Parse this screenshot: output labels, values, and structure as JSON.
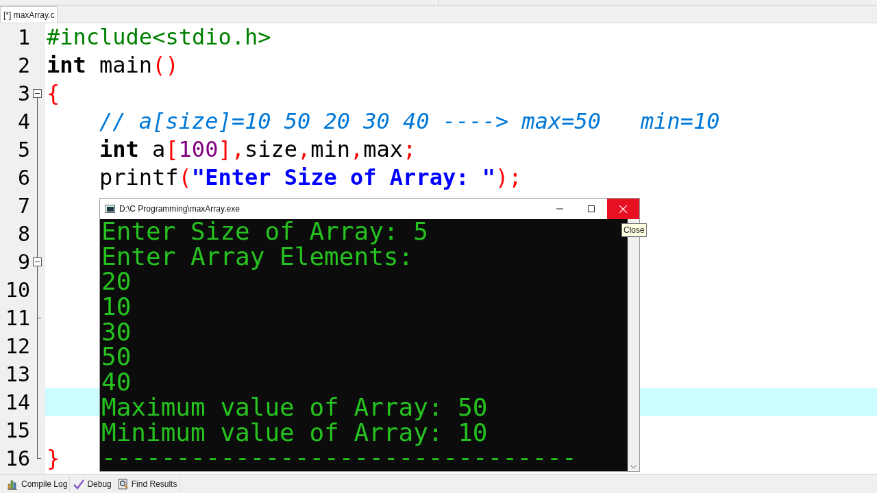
{
  "editor_tab": {
    "label": "[*] maxArray.c",
    "selected": true
  },
  "code_lines": [
    {
      "number": "1",
      "fold_marker": false,
      "fold_end": false,
      "indented": false,
      "current": false,
      "tokens": [
        {
          "kind": "preproc",
          "text": "#include<stdio.h>"
        }
      ]
    },
    {
      "number": "2",
      "fold_marker": false,
      "fold_end": false,
      "indented": false,
      "current": false,
      "tokens": [
        {
          "kind": "keyword",
          "text": "int"
        },
        {
          "kind": "plain",
          "text": " main"
        },
        {
          "kind": "symbol",
          "text": "()"
        }
      ]
    },
    {
      "number": "3",
      "fold_marker": true,
      "fold_end": false,
      "indented": false,
      "current": false,
      "tokens": [
        {
          "kind": "symbol",
          "text": "{"
        }
      ]
    },
    {
      "number": "4",
      "fold_marker": false,
      "fold_end": false,
      "indented": true,
      "current": false,
      "tokens": [
        {
          "kind": "comment",
          "text": "// a[size]=10 50 20 30 40 ----> max=50   min=10"
        }
      ]
    },
    {
      "number": "5",
      "fold_marker": false,
      "fold_end": false,
      "indented": true,
      "current": false,
      "tokens": [
        {
          "kind": "keyword",
          "text": "int"
        },
        {
          "kind": "plain",
          "text": " a"
        },
        {
          "kind": "symbol",
          "text": "["
        },
        {
          "kind": "number",
          "text": "100"
        },
        {
          "kind": "symbol",
          "text": "],"
        },
        {
          "kind": "plain",
          "text": "size"
        },
        {
          "kind": "symbol",
          "text": ","
        },
        {
          "kind": "plain",
          "text": "min"
        },
        {
          "kind": "symbol",
          "text": ","
        },
        {
          "kind": "plain",
          "text": "max"
        },
        {
          "kind": "symbol",
          "text": ";"
        }
      ]
    },
    {
      "number": "6",
      "fold_marker": false,
      "fold_end": false,
      "indented": true,
      "current": false,
      "tokens": [
        {
          "kind": "plain",
          "text": "printf"
        },
        {
          "kind": "symbol",
          "text": "("
        },
        {
          "kind": "string",
          "text": "\"Enter Size of Array: \""
        },
        {
          "kind": "symbol",
          "text": ");"
        }
      ]
    },
    {
      "number": "7",
      "fold_marker": false,
      "fold_end": false,
      "indented": false,
      "current": false
    },
    {
      "number": "8",
      "fold_marker": false,
      "fold_end": false,
      "indented": false,
      "current": false
    },
    {
      "number": "9",
      "fold_marker": true,
      "fold_end": false,
      "indented": false,
      "current": false
    },
    {
      "number": "10",
      "fold_marker": false,
      "fold_end": false,
      "indented": false,
      "current": false
    },
    {
      "number": "11",
      "fold_marker": false,
      "fold_end": true,
      "indented": false,
      "current": false
    },
    {
      "number": "12",
      "fold_marker": false,
      "fold_end": false,
      "indented": false,
      "current": false
    },
    {
      "number": "13",
      "fold_marker": false,
      "fold_end": false,
      "indented": false,
      "current": false
    },
    {
      "number": "14",
      "fold_marker": false,
      "fold_end": false,
      "indented": false,
      "current": true
    },
    {
      "number": "15",
      "fold_marker": false,
      "fold_end": false,
      "indented": false,
      "current": false
    },
    {
      "number": "16",
      "fold_marker": false,
      "fold_end": true,
      "indented": false,
      "current": false,
      "tokens": [
        {
          "kind": "symbol",
          "text": "}"
        }
      ]
    }
  ],
  "console": {
    "title": "D:\\C Programming\\maxArray.exe",
    "lines": [
      "Enter Size of Array: 5",
      "Enter Array Elements:",
      "20",
      "10",
      "30",
      "50",
      "40",
      "Maximum value of Array: 50",
      "Minimum value of Array: 10",
      "--------------------------------"
    ],
    "tooltip": "Close"
  },
  "bottom_tabs": [
    {
      "label": "Compile Log",
      "kind": "chart"
    },
    {
      "label": "Debug",
      "kind": "check"
    },
    {
      "label": "Find Results",
      "kind": "find"
    }
  ]
}
